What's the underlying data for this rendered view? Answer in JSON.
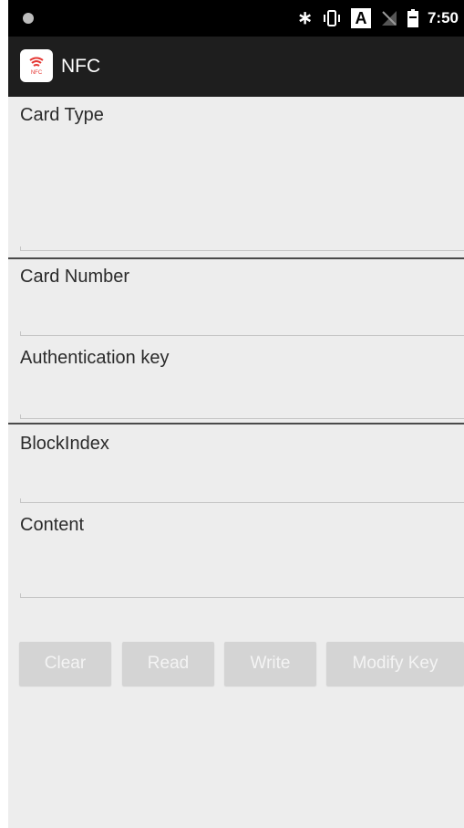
{
  "status_bar": {
    "time": "7:50",
    "a_indicator": "A",
    "icons": [
      "notification-dot-icon",
      "bluetooth-icon",
      "vibrate-icon",
      "no-signal-icon",
      "battery-icon"
    ]
  },
  "app_bar": {
    "title": "NFC",
    "icon": "nfc-app-icon",
    "icon_text": "NFC",
    "accent": "#e53935"
  },
  "fields": {
    "card_type": {
      "label": "Card Type",
      "value": ""
    },
    "card_number": {
      "label": "Card Number",
      "value": ""
    },
    "auth_key": {
      "label": "Authentication key",
      "value": ""
    },
    "block_index": {
      "label": "BlockIndex",
      "value": ""
    },
    "content": {
      "label": "Content",
      "value": ""
    }
  },
  "buttons": {
    "clear": "Clear",
    "read": "Read",
    "write": "Write",
    "modify_key": "Modify Key"
  },
  "colors": {
    "status_bar_bg": "#000000",
    "app_bar_bg": "#1e1e1e",
    "screen_bg": "#ededed",
    "button_bg": "#d4d4d4",
    "button_text": "#f4f4f4"
  }
}
